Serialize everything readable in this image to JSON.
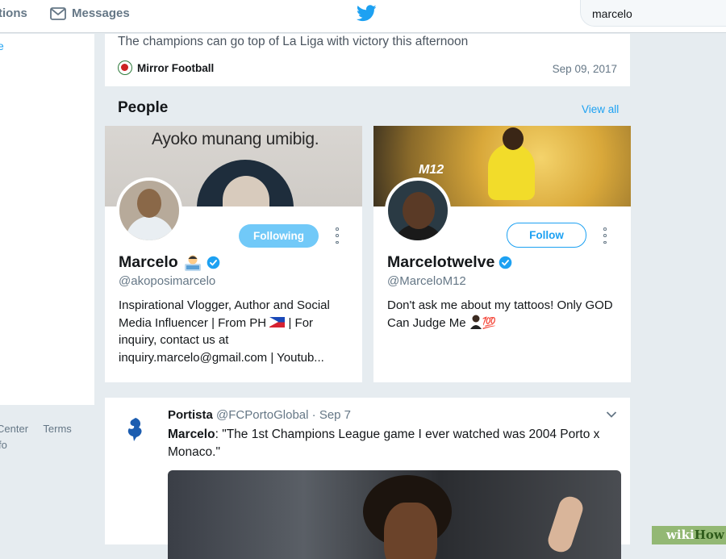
{
  "nav": {
    "notifications_label": "tions",
    "messages_label": "Messages",
    "search_value": "marcelo"
  },
  "left_panel": {
    "link_fragment": "e",
    "footer_row1": [
      "Center",
      "Terms"
    ],
    "footer_row2": "fo"
  },
  "news_tweet": {
    "text": "The champions can go top of La Liga with victory this afternoon",
    "source": "Mirror Football",
    "date": "Sep 09, 2017"
  },
  "people": {
    "title": "People",
    "view_all_label": "View all",
    "cards": [
      {
        "banner_text": "Ayoko munang umibig.",
        "name": "Marcelo",
        "handle": "@akoposimarcelo",
        "button_label": "Following",
        "bio_part1": "Inspirational Vlogger, Author and Social Media Influencer | From PH ",
        "bio_part2": " | For inquiry, contact us at inquiry.marcelo@gmail.com | Youtub...",
        "verified": true
      },
      {
        "banner_text": "M12",
        "name": "Marcelotwelve",
        "handle": "@MarceloM12",
        "button_label": "Follow",
        "bio_part1": "Don't ask me about my tattoos! Only GOD Can Judge Me ",
        "bio_emoji": "💯",
        "verified": true
      }
    ]
  },
  "tweet": {
    "author": "Portista",
    "handle": "@FCPortoGlobal",
    "separator": "·",
    "date": "Sep 7",
    "mention": "Marcelo",
    "text": ": \"The 1st Champions League game I ever watched was 2004 Porto x Monaco.\""
  },
  "watermark": {
    "part1": "wiki",
    "part2": "How"
  },
  "colors": {
    "accent": "#1da1f2",
    "background": "#e6ecf0",
    "muted_text": "#657786"
  }
}
